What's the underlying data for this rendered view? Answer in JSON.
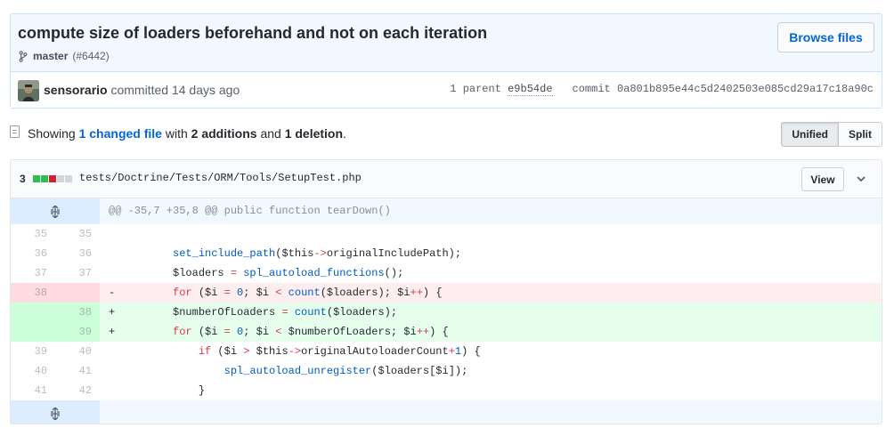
{
  "commit": {
    "title": "compute size of loaders beforehand and not on each iteration",
    "branch": "master",
    "pr": "(#6442)",
    "browse_label": "Browse files",
    "author": "sensorario",
    "action": "committed 14 days ago",
    "parent_label": "1 parent",
    "parent_sha": "e9b54de",
    "commit_label": "commit",
    "commit_sha": "0a801b895e44c5d2402503e085cd29a17c18a90c"
  },
  "toolbar": {
    "showing": "Showing",
    "changed": "1 changed file",
    "with": "with",
    "additions": "2 additions",
    "and": "and",
    "deletions": "1 deletion",
    "period": ".",
    "unified_label": "Unified",
    "split_label": "Split"
  },
  "file": {
    "changes": "3",
    "path": "tests/Doctrine/Tests/ORM/Tools/SetupTest.php",
    "view_label": "View",
    "diffstat_colors": [
      "#2cbe4e",
      "#2cbe4e",
      "#cb2431",
      "#d1d5da",
      "#d1d5da"
    ],
    "hunk_header": "@@ -35,7 +35,8 @@ public function tearDown()",
    "lines": [
      {
        "type": "ctx",
        "old": "35",
        "new": "35",
        "marker": " ",
        "code": ""
      },
      {
        "type": "ctx",
        "old": "36",
        "new": "36",
        "marker": " ",
        "code": "        set_include_path($this->originalIncludePath);"
      },
      {
        "type": "ctx",
        "old": "37",
        "new": "37",
        "marker": " ",
        "code": "        $loaders = spl_autoload_functions();"
      },
      {
        "type": "del",
        "old": "38",
        "new": "",
        "marker": "-",
        "code": "        for ($i = 0; $i < count($loaders); $i++) {"
      },
      {
        "type": "add",
        "old": "",
        "new": "38",
        "marker": "+",
        "code": "        $numberOfLoaders = count($loaders);"
      },
      {
        "type": "add",
        "old": "",
        "new": "39",
        "marker": "+",
        "code": "        for ($i = 0; $i < $numberOfLoaders; $i++) {"
      },
      {
        "type": "ctx",
        "old": "39",
        "new": "40",
        "marker": " ",
        "code": "            if ($i > $this->originalAutoloaderCount+1) {"
      },
      {
        "type": "ctx",
        "old": "40",
        "new": "41",
        "marker": " ",
        "code": "                spl_autoload_unregister($loaders[$i]);"
      },
      {
        "type": "ctx",
        "old": "41",
        "new": "42",
        "marker": " ",
        "code": "            }"
      }
    ]
  },
  "icons": {
    "branch": "git-branch-icon",
    "file": "file-diff-icon",
    "expand": "unfold-icon",
    "chevron": "chevron-down-icon"
  }
}
